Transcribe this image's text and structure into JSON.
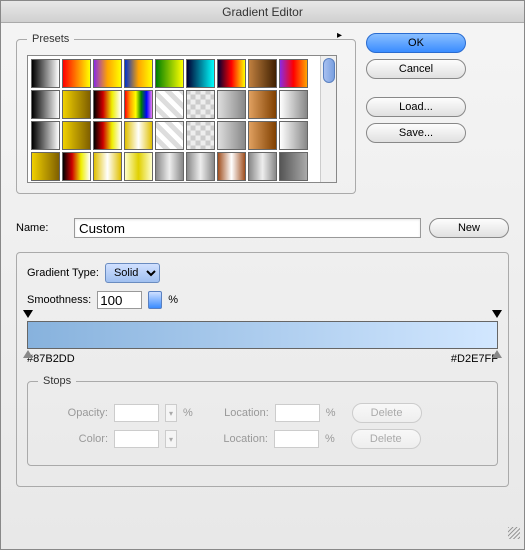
{
  "title": "Gradient Editor",
  "presets": {
    "legend": "Presets"
  },
  "buttons": {
    "ok": "OK",
    "cancel": "Cancel",
    "load": "Load...",
    "save": "Save...",
    "new": "New",
    "delete": "Delete"
  },
  "name": {
    "label": "Name:",
    "value": "Custom"
  },
  "gradientType": {
    "label": "Gradient Type:",
    "value": "Solid"
  },
  "smoothness": {
    "label": "Smoothness:",
    "value": "100",
    "unit": "%"
  },
  "gradient": {
    "startColor": "#87B2DD",
    "endColor": "#D2E7FF"
  },
  "stops": {
    "legend": "Stops",
    "opacity": {
      "label": "Opacity:",
      "value": "",
      "unit": "%"
    },
    "opacityLocation": {
      "label": "Location:",
      "value": "",
      "unit": "%"
    },
    "color": {
      "label": "Color:",
      "value": ""
    },
    "colorLocation": {
      "label": "Location:",
      "value": "",
      "unit": "%"
    }
  },
  "swatches": [
    "linear-gradient(90deg,#000,#fff)",
    "linear-gradient(90deg,red,yellow)",
    "linear-gradient(90deg,#8a2be2,orange,yellow)",
    "linear-gradient(90deg,#0033cc,orange,yellow)",
    "linear-gradient(90deg,green,yellow)",
    "linear-gradient(90deg,#003,cyan)",
    "linear-gradient(90deg,#003,red,yellow)",
    "linear-gradient(90deg,#c08040,#402000)",
    "linear-gradient(90deg,#8a2be2,red,orange)",
    "linear-gradient(90deg,#000,#fff)",
    "linear-gradient(90deg,#f0d000,#806000)",
    "linear-gradient(90deg,#000,#c00,#ee0,#fff)",
    "linear-gradient(90deg,red,orange,yellow,green,blue,violet)",
    "repeating-linear-gradient(45deg,#fff 0,#fff 5px,#ddd 5px,#ddd 10px)",
    "repeating-conic-gradient(#eee 0 25%,#ccc 0 50%) 50%/10px 10px",
    "linear-gradient(90deg,#ddd,#888)",
    "linear-gradient(90deg,#e0a060,#804000)",
    "linear-gradient(90deg,#fff,#888)",
    "linear-gradient(90deg,#000,#fff)",
    "linear-gradient(90deg,#f0d000,#806000)",
    "linear-gradient(90deg,#000,#c00,#ee0,#fff)",
    "linear-gradient(90deg,#e0c000,#fff,#e0c000)",
    "repeating-linear-gradient(45deg,#fff 0,#fff 5px,#ddd 5px,#ddd 10px)",
    "repeating-conic-gradient(#eee 0 25%,#ccc 0 50%) 50%/10px 10px",
    "linear-gradient(90deg,#ddd,#888)",
    "linear-gradient(90deg,#e0a060,#804000)",
    "linear-gradient(90deg,#fff,#888)",
    "linear-gradient(90deg,#f0d000,#806000)",
    "linear-gradient(90deg,#000,#c00,#ee0,#fff)",
    "linear-gradient(90deg,#e0c000,#fff,#e0c000)",
    "linear-gradient(90deg,#ffc,#e0d000,#ffc)",
    "linear-gradient(90deg,#888,#eee,#888)",
    "linear-gradient(90deg,#888,#eee,#888)",
    "linear-gradient(90deg,#a05020,#fff,#a05020)",
    "linear-gradient(90deg,#888,#eee,#888)",
    "linear-gradient(90deg,#555,#aaa)"
  ]
}
